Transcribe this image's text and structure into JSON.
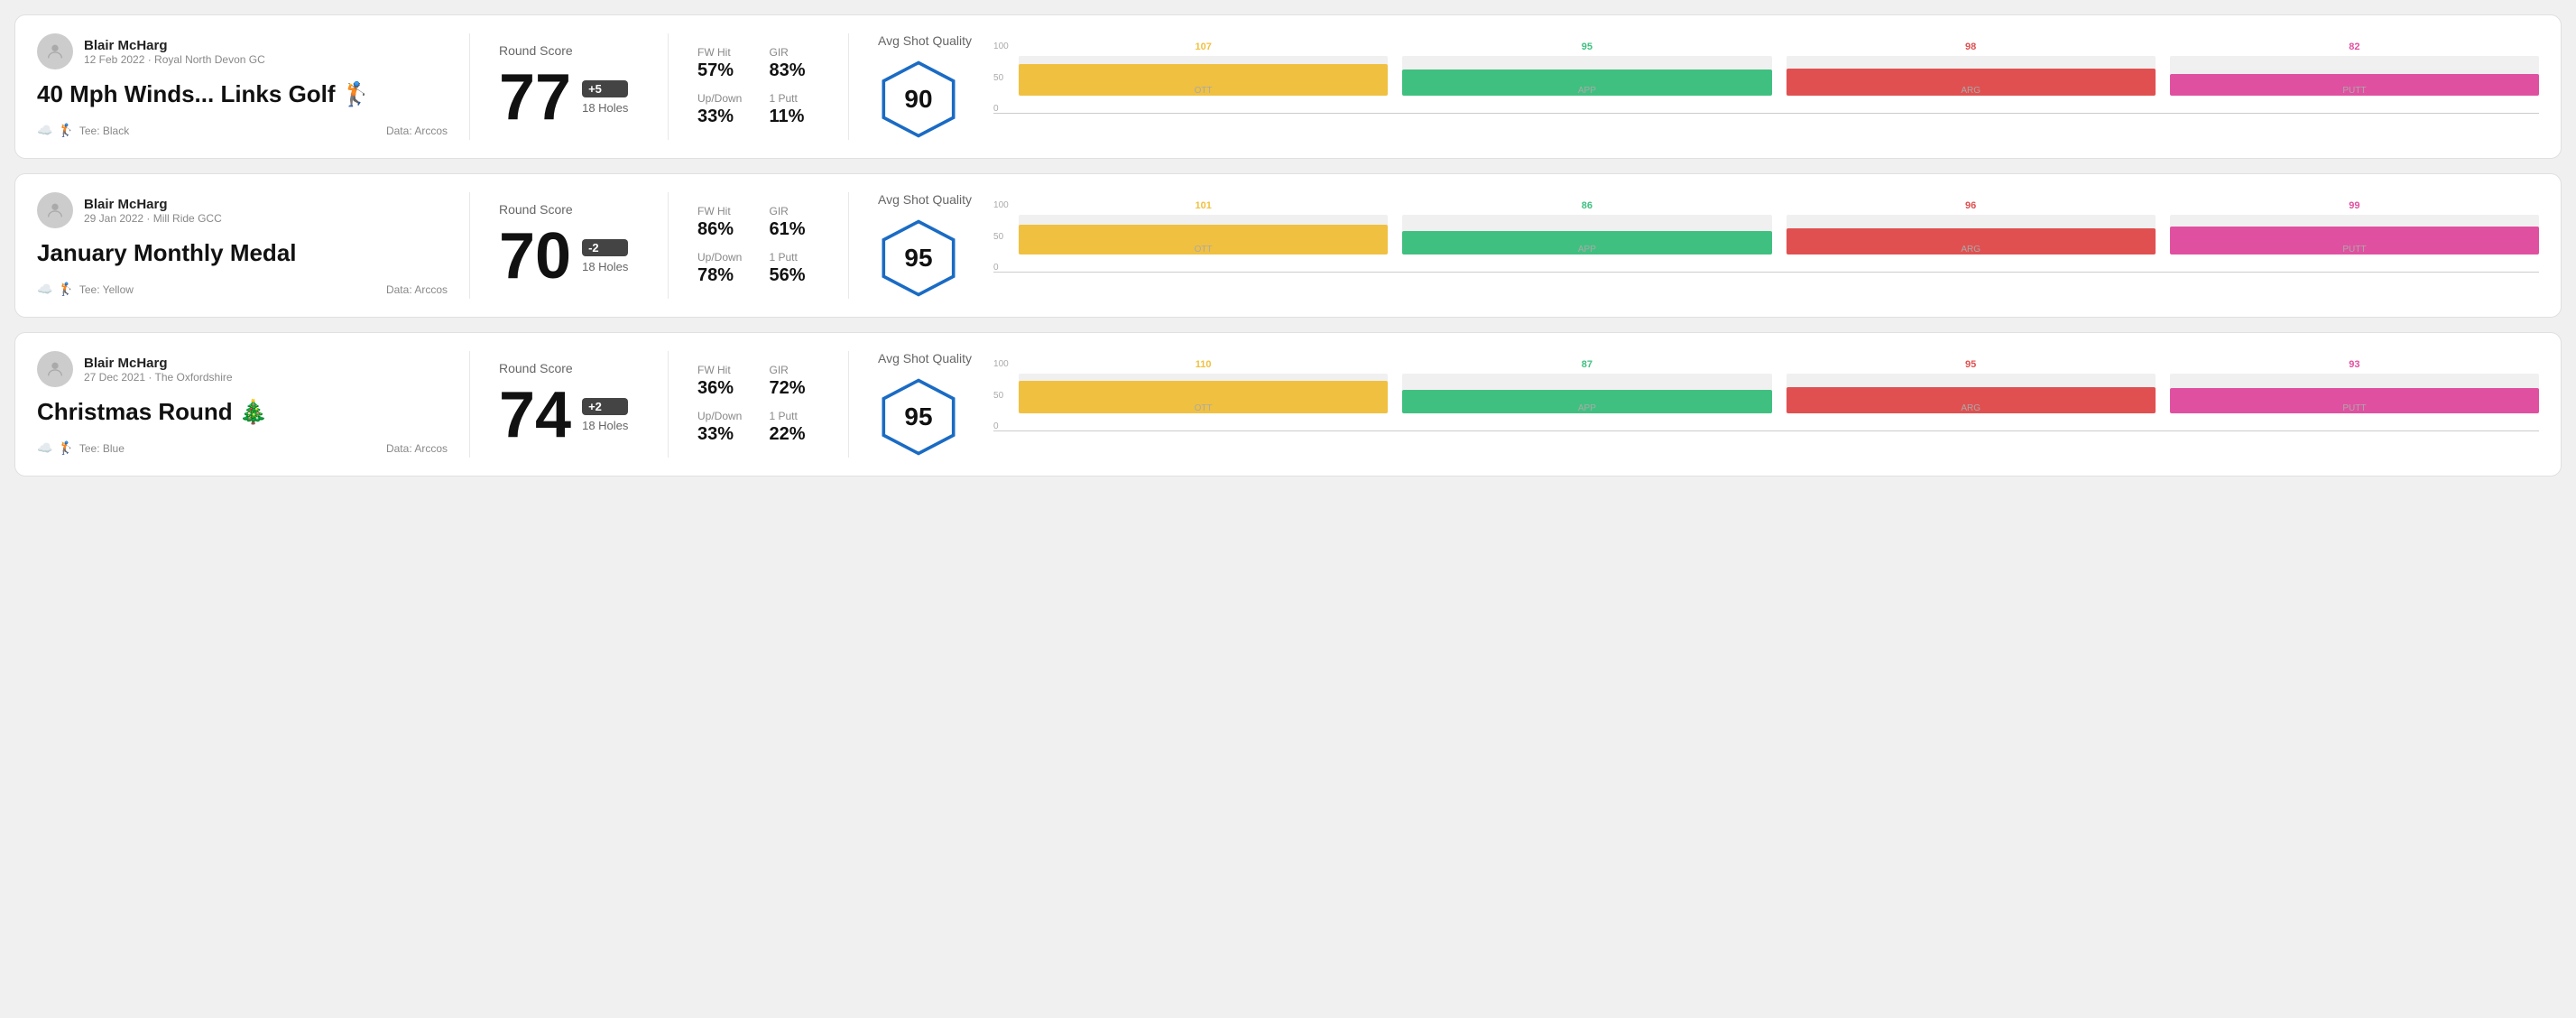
{
  "rounds": [
    {
      "id": "round1",
      "user_name": "Blair McHarg",
      "user_sub": "12 Feb 2022 · Royal North Devon GC",
      "round_title": "40 Mph Winds... Links Golf 🏌",
      "tee": "Tee: Black",
      "data_source": "Data: Arccos",
      "score": "77",
      "score_badge": "+5",
      "holes": "18 Holes",
      "fw_hit": "57%",
      "gir": "83%",
      "up_down": "33%",
      "one_putt": "11%",
      "avg_quality": "90",
      "chart": {
        "bars": [
          {
            "label": "OTT",
            "value": 107,
            "color": "#f0c040",
            "pct": 80
          },
          {
            "label": "APP",
            "value": 95,
            "color": "#40c080",
            "pct": 65
          },
          {
            "label": "ARG",
            "value": 98,
            "color": "#e05050",
            "pct": 68
          },
          {
            "label": "PUTT",
            "value": 82,
            "color": "#e050a0",
            "pct": 55
          }
        ]
      }
    },
    {
      "id": "round2",
      "user_name": "Blair McHarg",
      "user_sub": "29 Jan 2022 · Mill Ride GCC",
      "round_title": "January Monthly Medal",
      "tee": "Tee: Yellow",
      "data_source": "Data: Arccos",
      "score": "70",
      "score_badge": "-2",
      "holes": "18 Holes",
      "fw_hit": "86%",
      "gir": "61%",
      "up_down": "78%",
      "one_putt": "56%",
      "avg_quality": "95",
      "chart": {
        "bars": [
          {
            "label": "OTT",
            "value": 101,
            "color": "#f0c040",
            "pct": 76
          },
          {
            "label": "APP",
            "value": 86,
            "color": "#40c080",
            "pct": 58
          },
          {
            "label": "ARG",
            "value": 96,
            "color": "#e05050",
            "pct": 66
          },
          {
            "label": "PUTT",
            "value": 99,
            "color": "#e050a0",
            "pct": 70
          }
        ]
      }
    },
    {
      "id": "round3",
      "user_name": "Blair McHarg",
      "user_sub": "27 Dec 2021 · The Oxfordshire",
      "round_title": "Christmas Round 🎄",
      "tee": "Tee: Blue",
      "data_source": "Data: Arccos",
      "score": "74",
      "score_badge": "+2",
      "holes": "18 Holes",
      "fw_hit": "36%",
      "gir": "72%",
      "up_down": "33%",
      "one_putt": "22%",
      "avg_quality": "95",
      "chart": {
        "bars": [
          {
            "label": "OTT",
            "value": 110,
            "color": "#f0c040",
            "pct": 82
          },
          {
            "label": "APP",
            "value": 87,
            "color": "#40c080",
            "pct": 59
          },
          {
            "label": "ARG",
            "value": 95,
            "color": "#e05050",
            "pct": 65
          },
          {
            "label": "PUTT",
            "value": 93,
            "color": "#e050a0",
            "pct": 63
          }
        ]
      }
    }
  ],
  "labels": {
    "round_score": "Round Score",
    "fw_hit": "FW Hit",
    "gir": "GIR",
    "up_down": "Up/Down",
    "one_putt": "1 Putt",
    "avg_quality": "Avg Shot Quality"
  }
}
